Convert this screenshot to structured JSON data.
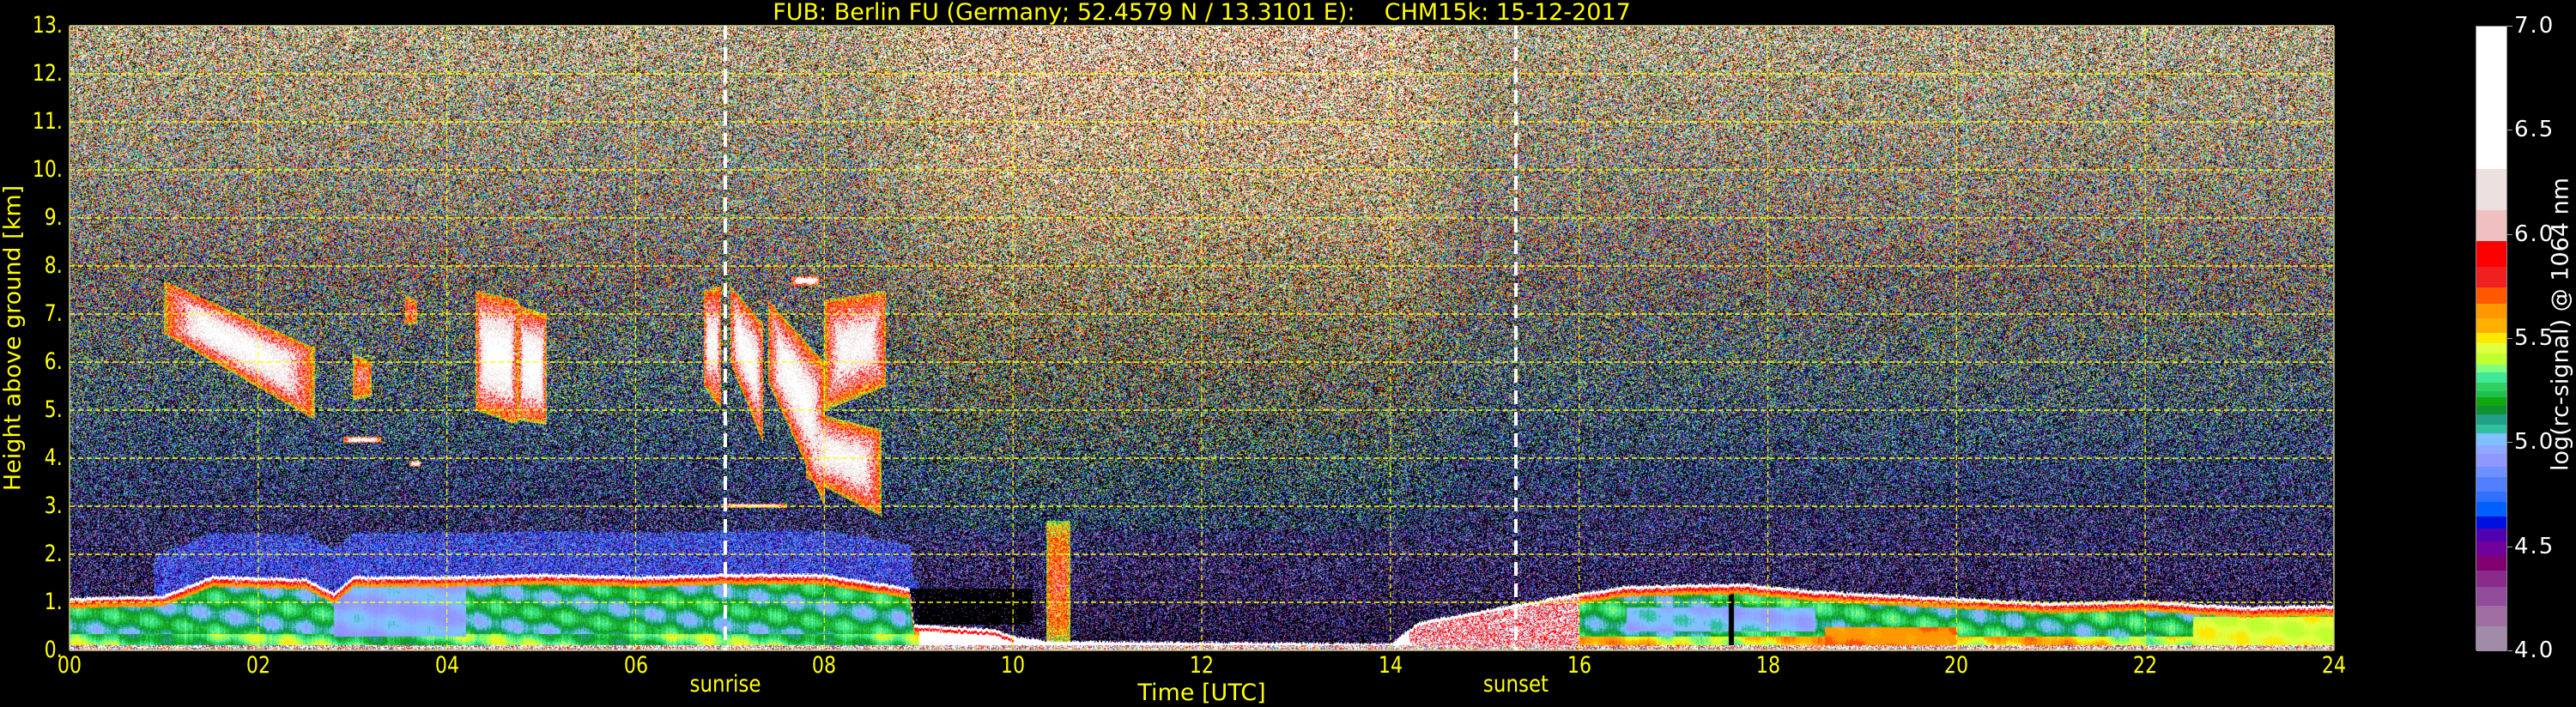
{
  "title": "FUB: Berlin FU (Germany; 52.4579 N / 13.3101 E):    CHM15k: 15-12-2017",
  "ylabel": "Height above ground [km]",
  "xlabel": "Time [UTC]",
  "colors": {
    "axis_text": "#ffff00",
    "grid": "#ffff00",
    "marker_line": "#ffffff",
    "background": "#000000"
  },
  "colorbar": {
    "label": "log(rc-signal) @ 1064 nm",
    "range": [
      4.0,
      7.0
    ],
    "ticks": [
      {
        "value": 4.0,
        "label": "4.0"
      },
      {
        "value": 4.5,
        "label": "4.5"
      },
      {
        "value": 5.0,
        "label": "5.0"
      },
      {
        "value": 5.5,
        "label": "5.5"
      },
      {
        "value": 6.0,
        "label": "6.0"
      },
      {
        "value": 6.5,
        "label": "6.5"
      },
      {
        "value": 7.0,
        "label": "7.0"
      }
    ],
    "levels": [
      4.0,
      4.12,
      4.22,
      4.31,
      4.39,
      4.46,
      4.53,
      4.59,
      4.65,
      4.72,
      4.77,
      4.84,
      4.89,
      4.95,
      4.99,
      5.05,
      5.09,
      5.14,
      5.18,
      5.22,
      5.25,
      5.29,
      5.34,
      5.38,
      5.43,
      5.48,
      5.53,
      5.6,
      5.67,
      5.75,
      5.85,
      5.97,
      6.12,
      6.32,
      7.0
    ],
    "colors": [
      "#a08ca8",
      "#a06ea0",
      "#904c98",
      "#8a2a8a",
      "#800070",
      "#70009a",
      "#5000b0",
      "#0010e0",
      "#0060ff",
      "#3070ff",
      "#5080ff",
      "#7090ff",
      "#9098ff",
      "#90a8ff",
      "#80c0ff",
      "#30c0a0",
      "#20a088",
      "#109030",
      "#10a810",
      "#20c050",
      "#30d060",
      "#40e898",
      "#80ff80",
      "#c0ff30",
      "#e0ff40",
      "#ffe800",
      "#ffb000",
      "#ff9800",
      "#ff5800",
      "#f02020",
      "#ff0000",
      "#f0c0c0",
      "#ece0e0",
      "#ffffff"
    ]
  },
  "chart_data": {
    "type": "heatmap",
    "title": "FUB: Berlin FU (Germany; 52.4579 N / 13.3101 E):    CHM15k: 15-12-2017",
    "xlabel": "Time [UTC]",
    "ylabel": "Height above ground [km]",
    "xlim": [
      0,
      24
    ],
    "ylim": [
      0,
      13
    ],
    "grid": true,
    "xticks": [
      {
        "value": 0,
        "label": "00"
      },
      {
        "value": 2,
        "label": "02"
      },
      {
        "value": 4,
        "label": "04"
      },
      {
        "value": 6,
        "label": "06"
      },
      {
        "value": 8,
        "label": "08"
      },
      {
        "value": 10,
        "label": "10"
      },
      {
        "value": 12,
        "label": "12"
      },
      {
        "value": 14,
        "label": "14"
      },
      {
        "value": 16,
        "label": "16"
      },
      {
        "value": 18,
        "label": "18"
      },
      {
        "value": 20,
        "label": "20"
      },
      {
        "value": 22,
        "label": "22"
      },
      {
        "value": 24,
        "label": "24"
      }
    ],
    "yticks": [
      {
        "value": 0,
        "label": "0."
      },
      {
        "value": 1,
        "label": "1."
      },
      {
        "value": 2,
        "label": "2."
      },
      {
        "value": 3,
        "label": "3."
      },
      {
        "value": 4,
        "label": "4."
      },
      {
        "value": 5,
        "label": "5."
      },
      {
        "value": 6,
        "label": "6."
      },
      {
        "value": 7,
        "label": "7."
      },
      {
        "value": 8,
        "label": "8."
      },
      {
        "value": 9,
        "label": "9."
      },
      {
        "value": 10,
        "label": "10."
      },
      {
        "value": 11,
        "label": "11."
      },
      {
        "value": 12,
        "label": "12."
      },
      {
        "value": 13,
        "label": "13."
      }
    ],
    "markers": [
      {
        "label": "sunrise",
        "time_utc": 6.95
      },
      {
        "label": "sunset",
        "time_utc": 15.33
      }
    ],
    "boundary_layer_top_km": [
      [
        0,
        1.1
      ],
      [
        1,
        1.15
      ],
      [
        1.5,
        1.55
      ],
      [
        2.5,
        1.5
      ],
      [
        2.8,
        1.2
      ],
      [
        3,
        1.55
      ],
      [
        4,
        1.55
      ],
      [
        5,
        1.6
      ],
      [
        6,
        1.55
      ],
      [
        7,
        1.6
      ],
      [
        8,
        1.6
      ],
      [
        8.9,
        1.3
      ],
      [
        8.95,
        0.55
      ],
      [
        9.8,
        0.45
      ],
      [
        10,
        0.3
      ],
      [
        10.4,
        0.2
      ],
      [
        14,
        0.15
      ],
      [
        14.3,
        0.6
      ],
      [
        15,
        0.85
      ],
      [
        16,
        1.2
      ],
      [
        16.5,
        1.35
      ],
      [
        17.7,
        1.4
      ],
      [
        18.5,
        1.25
      ],
      [
        20,
        1.1
      ],
      [
        21,
        1.0
      ],
      [
        22,
        1.05
      ],
      [
        23,
        0.92
      ],
      [
        24,
        0.95
      ]
    ],
    "clouds": [
      {
        "t": [
          1.0,
          2.6
        ],
        "base_km": [
          6.6,
          4.8
        ],
        "top_km": [
          7.7,
          6.3
        ],
        "peak": 6.6
      },
      {
        "t": [
          3.0,
          3.2
        ],
        "base_km": [
          5.2,
          5.3
        ],
        "top_km": [
          6.2,
          6.0
        ],
        "peak": 6.0
      },
      {
        "t": [
          3.55,
          3.68
        ],
        "base_km": [
          6.8,
          6.8
        ],
        "top_km": [
          7.4,
          7.3
        ],
        "peak": 6.0
      },
      {
        "t": [
          4.3,
          4.75
        ],
        "base_km": [
          5.0,
          4.7
        ],
        "top_km": [
          7.5,
          7.3
        ],
        "peak": 6.7
      },
      {
        "t": [
          4.75,
          5.05
        ],
        "base_km": [
          4.8,
          4.7
        ],
        "top_km": [
          7.2,
          7.0
        ],
        "peak": 6.7
      },
      {
        "t": [
          6.72,
          6.9
        ],
        "base_km": [
          5.5,
          5.0
        ],
        "top_km": [
          7.5,
          7.6
        ],
        "peak": 6.5
      },
      {
        "t": [
          7.0,
          7.35
        ],
        "base_km": [
          6.0,
          4.3
        ],
        "top_km": [
          7.6,
          6.8
        ],
        "peak": 6.6
      },
      {
        "t": [
          7.4,
          8.0
        ],
        "base_km": [
          5.6,
          3.0
        ],
        "top_km": [
          7.3,
          6.0
        ],
        "peak": 6.6
      },
      {
        "t": [
          7.8,
          8.6
        ],
        "base_km": [
          3.6,
          2.8
        ],
        "top_km": [
          5.0,
          4.6
        ],
        "peak": 6.5
      },
      {
        "t": [
          8.0,
          8.65
        ],
        "base_km": [
          5.0,
          5.5
        ],
        "top_km": [
          7.3,
          7.5
        ],
        "peak": 6.5
      },
      {
        "t": [
          7.65,
          7.95
        ],
        "base_km": [
          7.6,
          7.6
        ],
        "top_km": [
          7.8,
          7.8
        ],
        "peak": 6.6
      },
      {
        "t": [
          2.9,
          3.3
        ],
        "base_km": [
          4.33,
          4.33
        ],
        "top_km": [
          4.45,
          4.45
        ],
        "peak": 6.6
      },
      {
        "t": [
          3.6,
          3.72
        ],
        "base_km": [
          3.83,
          3.83
        ],
        "top_km": [
          3.95,
          3.95
        ],
        "peak": 6.6
      },
      {
        "t": [
          6.9,
          7.6
        ],
        "base_km": [
          2.98,
          2.98
        ],
        "top_km": [
          3.06,
          3.06
        ],
        "peak": 6.6
      },
      {
        "t": [
          10.35,
          10.6
        ],
        "base_km": [
          0.1,
          0.1
        ],
        "top_km": [
          2.7,
          2.7
        ],
        "peak": 5.9
      }
    ]
  }
}
